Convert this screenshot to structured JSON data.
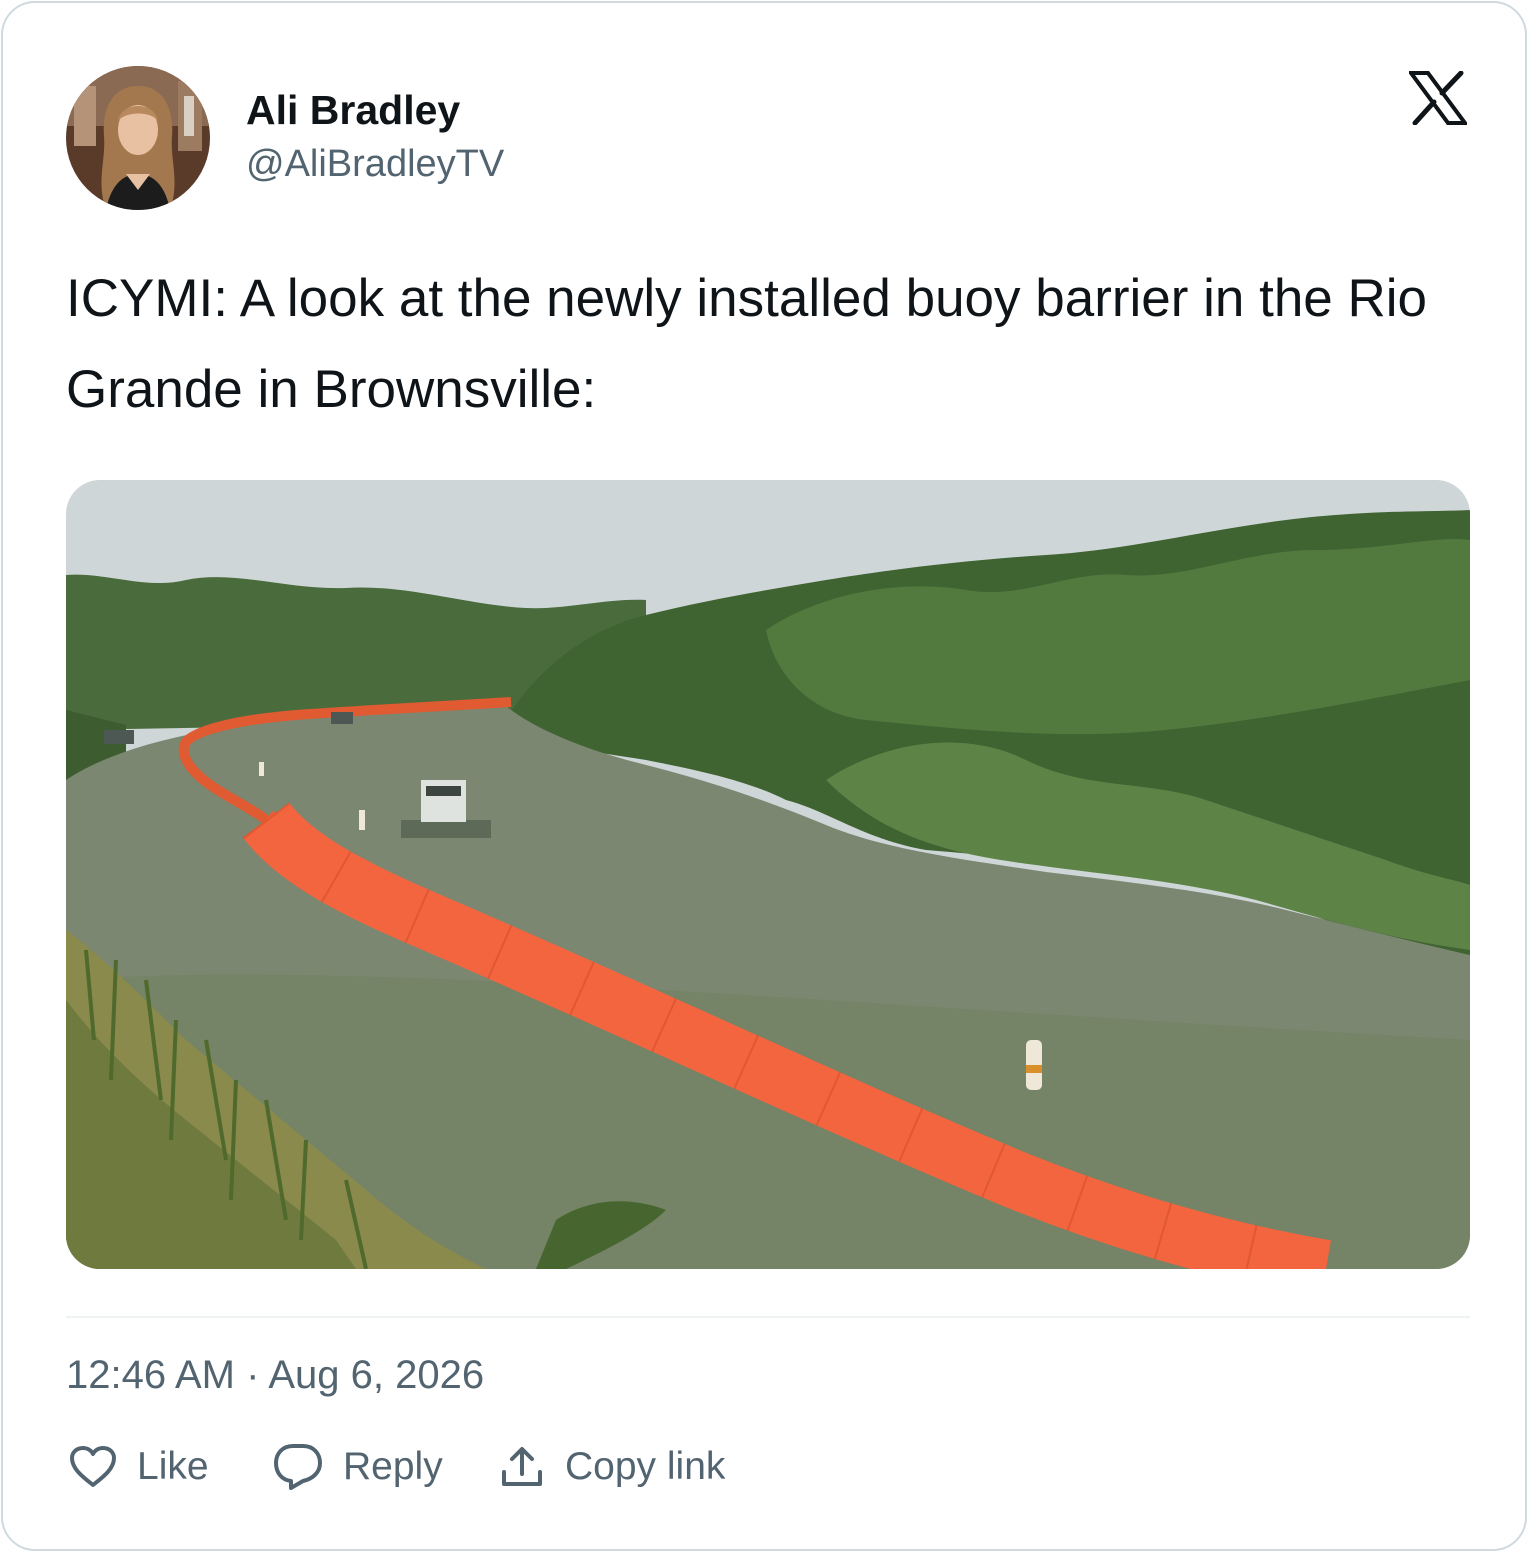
{
  "author": {
    "name": "Ali Bradley",
    "handle": "@AliBradleyTV"
  },
  "tweet": {
    "text": "ICYMI: A look at the newly installed buoy barrier in the Rio Grande in Brownsville:"
  },
  "meta": {
    "time": "12:46 AM",
    "separator": "·",
    "date": "Aug 6, 2026"
  },
  "actions": {
    "like": "Like",
    "reply": "Reply",
    "copy_link": "Copy link"
  },
  "colors": {
    "text": "#0f1419",
    "secondary": "#536471",
    "border": "#cfd9de",
    "buoy_orange": "#f2653f"
  },
  "icons": {
    "brand": "x-logo-icon",
    "like": "heart-icon",
    "reply": "speech-bubble-icon",
    "copy": "share-upload-icon"
  }
}
